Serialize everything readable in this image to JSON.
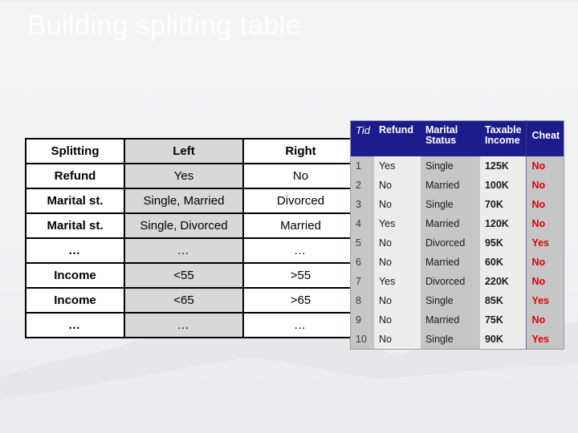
{
  "slide": {
    "title": "Building splitting table",
    "title_color": "#fdfdfd",
    "background_color": "#f2f2f3"
  },
  "splitting_table": {
    "columns": [
      "Splitting",
      "Left",
      "Right"
    ],
    "highlight_column": "Left",
    "highlight_color": "#d8d8d8",
    "rows": [
      {
        "splitting": "Refund",
        "left": "Yes",
        "right": "No"
      },
      {
        "splitting": "Marital st.",
        "left": "Single, Married",
        "right": "Divorced"
      },
      {
        "splitting": "Marital st.",
        "left": "Single, Divorced",
        "right": "Married"
      },
      {
        "splitting": "…",
        "left": "…",
        "right": "…"
      },
      {
        "splitting": "Income",
        "left": "<55",
        "right": ">55"
      },
      {
        "splitting": "Income",
        "left": "<65",
        "right": ">65"
      },
      {
        "splitting": "…",
        "left": "…",
        "right": "…"
      }
    ]
  },
  "data_table": {
    "header_color": "#1c1c8c",
    "cheat_value_color": "#e00000",
    "columns": [
      "Tid",
      "Refund",
      "Marital Status",
      "Taxable Income",
      "Cheat"
    ],
    "column_header_lines": {
      "tid": "Tid",
      "refund": "Refund",
      "marital_line1": "Marital",
      "marital_line2": "Status",
      "income_line1": "Taxable",
      "income_line2": "Income",
      "cheat": "Cheat"
    },
    "rows": [
      {
        "tid": "1",
        "refund": "Yes",
        "marital": "Single",
        "income": "125K",
        "cheat": "No"
      },
      {
        "tid": "2",
        "refund": "No",
        "marital": "Married",
        "income": "100K",
        "cheat": "No"
      },
      {
        "tid": "3",
        "refund": "No",
        "marital": "Single",
        "income": "70K",
        "cheat": "No"
      },
      {
        "tid": "4",
        "refund": "Yes",
        "marital": "Married",
        "income": "120K",
        "cheat": "No"
      },
      {
        "tid": "5",
        "refund": "No",
        "marital": "Divorced",
        "income": "95K",
        "cheat": "Yes"
      },
      {
        "tid": "6",
        "refund": "No",
        "marital": "Married",
        "income": "60K",
        "cheat": "No"
      },
      {
        "tid": "7",
        "refund": "Yes",
        "marital": "Divorced",
        "income": "220K",
        "cheat": "No"
      },
      {
        "tid": "8",
        "refund": "No",
        "marital": "Single",
        "income": "85K",
        "cheat": "Yes"
      },
      {
        "tid": "9",
        "refund": "No",
        "marital": "Married",
        "income": "75K",
        "cheat": "No"
      },
      {
        "tid": "10",
        "refund": "No",
        "marital": "Single",
        "income": "90K",
        "cheat": "Yes"
      }
    ]
  }
}
